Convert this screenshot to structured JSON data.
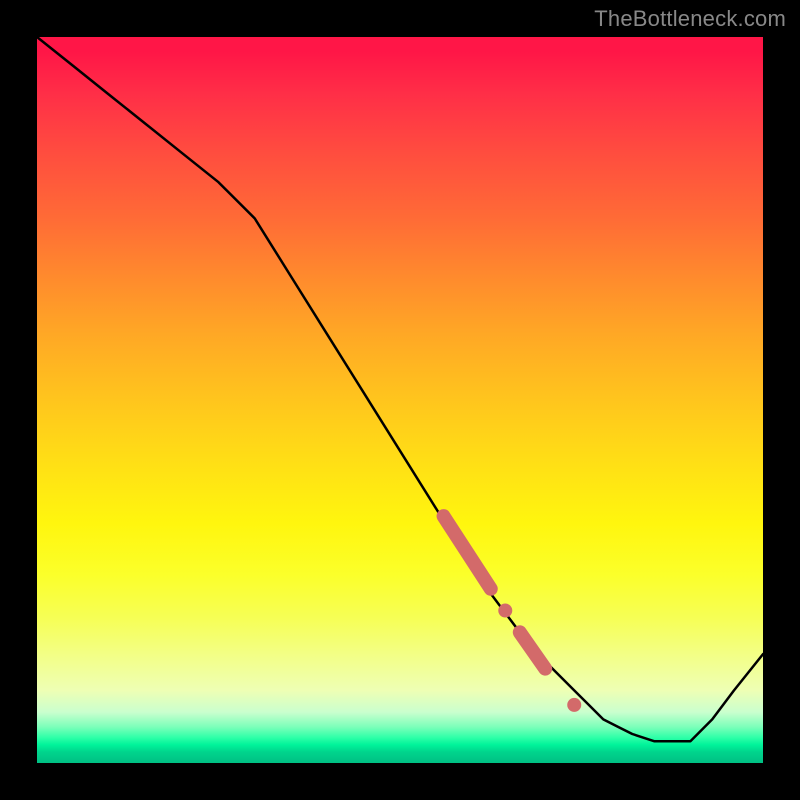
{
  "watermark": "TheBottleneck.com",
  "chart_data": {
    "type": "line",
    "title": "",
    "xlabel": "",
    "ylabel": "",
    "xlim": [
      0,
      100
    ],
    "ylim": [
      0,
      100
    ],
    "series": [
      {
        "name": "curve",
        "x": [
          0,
          5,
          10,
          15,
          20,
          25,
          30,
          35,
          40,
          45,
          50,
          55,
          60,
          62,
          65,
          68,
          70,
          72,
          74,
          76,
          78,
          80,
          82,
          85,
          88,
          90,
          93,
          96,
          100
        ],
        "y": [
          100,
          96,
          92,
          88,
          84,
          80,
          75,
          67,
          59,
          51,
          43,
          35,
          27,
          24,
          20,
          16,
          14,
          12,
          10,
          8,
          6,
          5,
          4,
          3,
          3,
          3,
          6,
          10,
          15
        ]
      }
    ],
    "markers": [
      {
        "name": "segment-a",
        "type": "thick",
        "x": [
          56,
          62.5
        ],
        "y": [
          34,
          24
        ]
      },
      {
        "name": "dot-b",
        "type": "dot",
        "x": 64.5,
        "y": 21
      },
      {
        "name": "segment-c",
        "type": "thick",
        "x": [
          66.5,
          70
        ],
        "y": [
          18,
          13
        ]
      },
      {
        "name": "dot-d",
        "type": "dot",
        "x": 74,
        "y": 8
      }
    ],
    "colors": {
      "line": "#000000",
      "marker": "#d36a6a"
    }
  }
}
